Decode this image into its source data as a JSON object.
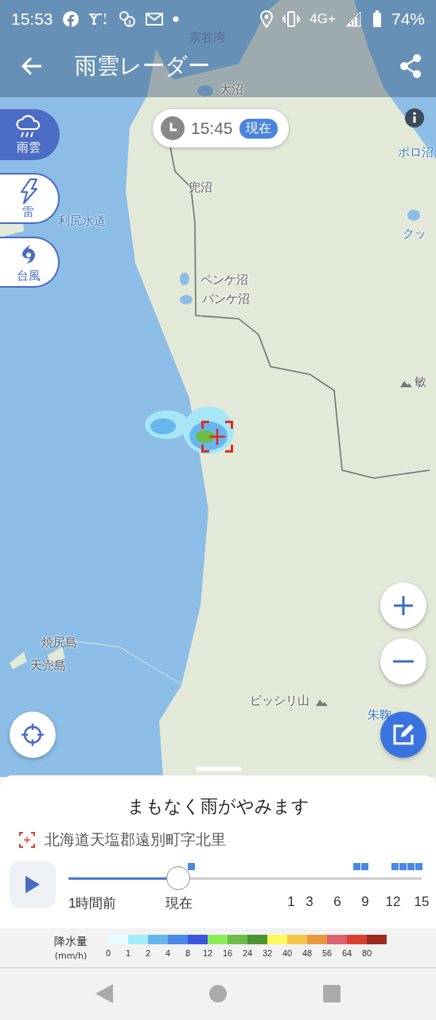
{
  "status_bar": {
    "time": "15:53",
    "network": "4G+",
    "battery": "74%"
  },
  "header": {
    "title": "雨雲レーダー"
  },
  "time_pill": {
    "time": "15:45",
    "badge": "現在"
  },
  "layers": [
    {
      "label": "雨雲",
      "kind": "rain",
      "selected": true
    },
    {
      "label": "雷",
      "kind": "thunder",
      "selected": false
    },
    {
      "label": "台風",
      "kind": "typhoon",
      "selected": false
    }
  ],
  "map_labels": [
    {
      "text": "宗谷湾",
      "kind": "sea"
    },
    {
      "text": "大沼",
      "kind": "land"
    },
    {
      "text": "ポロ沼",
      "kind": "water"
    },
    {
      "text": "兜沼",
      "kind": "land"
    },
    {
      "text": "利尻水道",
      "kind": "water"
    },
    {
      "text": "クッ",
      "kind": "water"
    },
    {
      "text": "ペンケ沼",
      "kind": "land"
    },
    {
      "text": "パンケ沼",
      "kind": "land"
    },
    {
      "text": "敏",
      "kind": "land"
    },
    {
      "text": "焼尻島",
      "kind": "land"
    },
    {
      "text": "天売島",
      "kind": "land"
    },
    {
      "text": "ピッシリ山",
      "kind": "land"
    },
    {
      "text": "朱鞠",
      "kind": "water"
    }
  ],
  "forecast": {
    "message": "まもなく雨がやみます",
    "location": "北海道天塩郡遠別町字北里"
  },
  "timeline": {
    "level": 0.31,
    "labels": [
      "1時間前",
      "現在",
      "1",
      "3",
      "6",
      "9",
      "12",
      "15"
    ]
  },
  "legend": {
    "title": "降水量",
    "unit": "(mm/h)",
    "items": [
      {
        "label": "0",
        "color": "#e4fbff"
      },
      {
        "label": "1",
        "color": "#a2eefa"
      },
      {
        "label": "2",
        "color": "#68b6ef"
      },
      {
        "label": "4",
        "color": "#4a88e6"
      },
      {
        "label": "8",
        "color": "#3b55dd"
      },
      {
        "label": "12",
        "color": "#8aec58"
      },
      {
        "label": "16",
        "color": "#6cbd48"
      },
      {
        "label": "24",
        "color": "#4b9432"
      },
      {
        "label": "32",
        "color": "#fdfb5c"
      },
      {
        "label": "40",
        "color": "#f3c64a"
      },
      {
        "label": "48",
        "color": "#e69a3b"
      },
      {
        "label": "56",
        "color": "#dd6270"
      },
      {
        "label": "64",
        "color": "#d8412e"
      },
      {
        "label": "80",
        "color": "#9f2a20"
      }
    ]
  }
}
